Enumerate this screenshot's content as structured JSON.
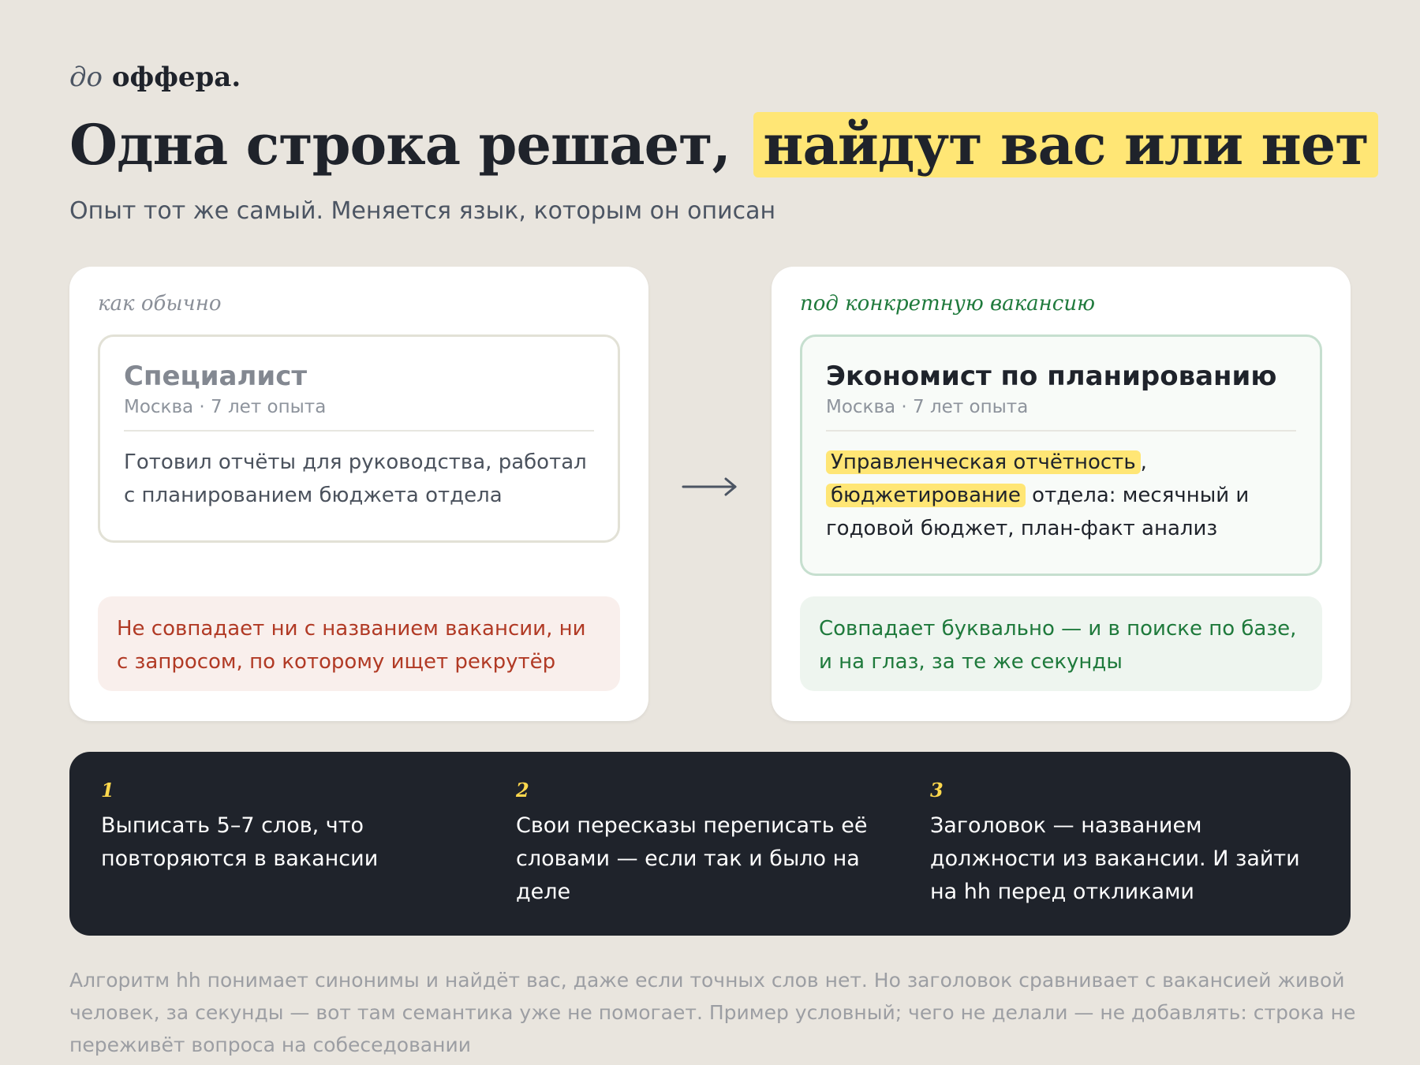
{
  "brand": {
    "prefix": "до",
    "name": "оффера."
  },
  "header": {
    "title_main": "Одна строка решает,",
    "title_highlight": "найдут вас или нет",
    "subtitle": "Опыт тот же самый. Меняется язык, которым он описан"
  },
  "before": {
    "label": "как обычно",
    "resume_title": "Специалист",
    "resume_meta": "Москва · 7 лет опыта",
    "resume_body": "Готовил отчёты для руководства, работал с планированием бюджета отдела",
    "verdict": "Не совпадает ни с названием вакансии, ни с запросом, по которому ищет рекрутёр"
  },
  "arrow_icon": "arrow-right-icon",
  "after": {
    "label": "под конкретную вакансию",
    "resume_title": "Экономист по планированию",
    "resume_meta": "Москва · 7 лет опыта",
    "keyword_1": "Управленческая отчётность",
    "sep": ",",
    "keyword_2": "бюджетирование",
    "body_rest": " отдела: месячный и годовой бюджет, план-факт анализ",
    "verdict": "Совпадает буквально — и в поиске по базе, и на глаз, за те же секунды"
  },
  "steps": [
    {
      "num": "1",
      "text": "Выписать 5–7 слов, что повторяются в вакансии"
    },
    {
      "num": "2",
      "text": "Свои пересказы переписать её словами — если так и было на деле"
    },
    {
      "num": "3",
      "text": "Заголовок — названием должности из вакансии. И зайти на hh перед откликами"
    }
  ],
  "footnote": "Алгоритм hh понимает синонимы и найдёт вас, даже если точных слов нет. Но заголовок сравнивает с вакансией живой человек, за секунды — вот там семантика уже не помогает. Пример условный; чего не делали — не добавлять: строка не переживёт вопроса на собеседовании",
  "colors": {
    "background": "#e9e5de",
    "highlight": "#ffe675",
    "negative": "#b13a25",
    "positive": "#1f7a3c",
    "dark_panel": "#1f232b",
    "step_number": "#ffd84d"
  }
}
